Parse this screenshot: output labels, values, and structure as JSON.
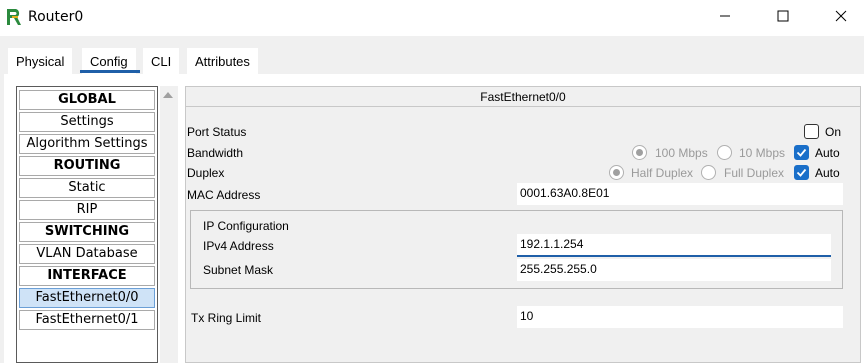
{
  "window": {
    "title": "Router0",
    "icons": {
      "app": "router-app-icon",
      "minimize": "minimize-icon",
      "maximize": "maximize-icon",
      "close": "close-icon"
    }
  },
  "tabs": [
    {
      "label": "Physical"
    },
    {
      "label": "Config"
    },
    {
      "label": "CLI"
    },
    {
      "label": "Attributes"
    }
  ],
  "nav": {
    "items": [
      {
        "label": "GLOBAL",
        "type": "header"
      },
      {
        "label": "Settings",
        "type": "item"
      },
      {
        "label": "Algorithm Settings",
        "type": "item"
      },
      {
        "label": "ROUTING",
        "type": "header"
      },
      {
        "label": "Static",
        "type": "item"
      },
      {
        "label": "RIP",
        "type": "item"
      },
      {
        "label": "SWITCHING",
        "type": "header"
      },
      {
        "label": "VLAN Database",
        "type": "item"
      },
      {
        "label": "INTERFACE",
        "type": "header"
      },
      {
        "label": "FastEthernet0/0",
        "type": "item",
        "selected": true
      },
      {
        "label": "FastEthernet0/1",
        "type": "item"
      }
    ]
  },
  "panel": {
    "title": "FastEthernet0/0",
    "port_status": {
      "label": "Port Status",
      "on_label": "On",
      "on_checked": false
    },
    "bandwidth": {
      "label": "Bandwidth",
      "opt1": "100 Mbps",
      "opt2": "10 Mbps",
      "auto_label": "Auto",
      "auto_checked": true
    },
    "duplex": {
      "label": "Duplex",
      "opt1": "Half Duplex",
      "opt2": "Full Duplex",
      "auto_label": "Auto",
      "auto_checked": true
    },
    "mac": {
      "label": "MAC Address",
      "value": "0001.63A0.8E01"
    },
    "ip_config": {
      "title": "IP Configuration",
      "ipv4_label": "IPv4 Address",
      "ipv4_value": "192.1.1.254",
      "mask_label": "Subnet Mask",
      "mask_value": "255.255.255.0"
    },
    "tx_ring": {
      "label": "Tx Ring Limit",
      "value": "10"
    }
  },
  "colors": {
    "accent": "#1a6fc9",
    "selection": "#cfe3f7"
  }
}
